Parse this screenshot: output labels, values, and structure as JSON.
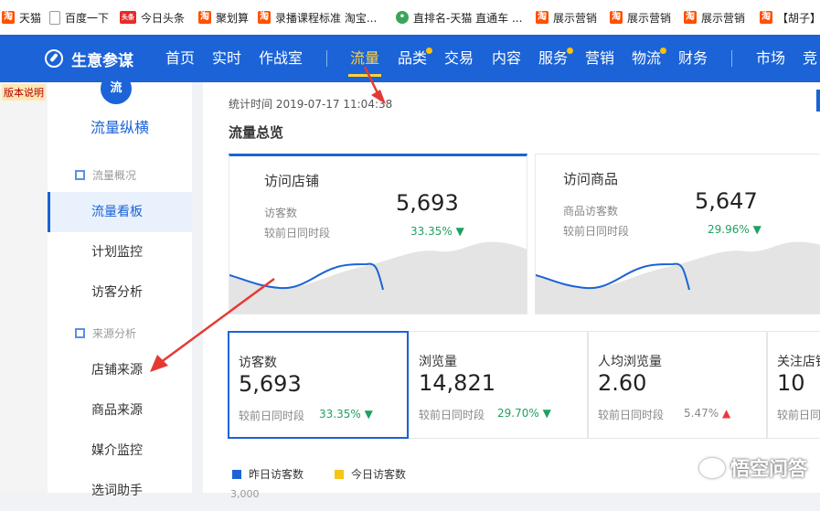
{
  "bookmarks": [
    {
      "icon": "taobao-icon",
      "label": "天猫"
    },
    {
      "icon": "doc-icon",
      "label": "百度一下"
    },
    {
      "icon": "toutiao-icon",
      "label": "今日头条"
    },
    {
      "icon": "taobao-icon",
      "label": "聚划算"
    },
    {
      "icon": "taobao-icon",
      "label": "录播课程标准 淘宝..."
    },
    {
      "icon": "globe-icon",
      "label": "直排名-天猫 直通车 ..."
    },
    {
      "icon": "taobao-icon",
      "label": "展示营销"
    },
    {
      "icon": "taobao-icon",
      "label": "展示营销"
    },
    {
      "icon": "taobao-icon",
      "label": "展示营销"
    },
    {
      "icon": "taobao-icon",
      "label": "【胡子】"
    }
  ],
  "nav": {
    "logo_text": "生意参谋",
    "items": [
      {
        "label": "首页"
      },
      {
        "label": "实时"
      },
      {
        "label": "作战室"
      },
      {
        "label": "流量",
        "active": true
      },
      {
        "label": "品类",
        "dot": true
      },
      {
        "label": "交易"
      },
      {
        "label": "内容"
      },
      {
        "label": "服务",
        "dot": true
      },
      {
        "label": "营销"
      },
      {
        "label": "物流",
        "dot": true
      },
      {
        "label": "财务"
      },
      {
        "label": "市场"
      },
      {
        "label": "竞"
      }
    ]
  },
  "version_note": "版本说明",
  "sidebar": {
    "logo_char": "流",
    "title": "流量纵横",
    "group1": "流量概况",
    "items1": [
      {
        "label": "流量看板",
        "active": true
      },
      {
        "label": "计划监控"
      },
      {
        "label": "访客分析"
      }
    ],
    "group2": "来源分析",
    "items2": [
      {
        "label": "店铺来源"
      },
      {
        "label": "商品来源"
      },
      {
        "label": "媒介监控"
      },
      {
        "label": "选词助手"
      }
    ]
  },
  "main": {
    "stat_time": "统计时间 2019-07-17 11:04:38",
    "header": "流量总览",
    "cards": [
      {
        "title": "访问店铺",
        "label1": "访客数",
        "value": "5,693",
        "label2": "较前日同时段",
        "pct": "33.35%",
        "trend": "down"
      },
      {
        "title": "访问商品",
        "label1": "商品访客数",
        "value": "5,647",
        "label2": "较前日同时段",
        "pct": "29.96%",
        "trend": "down"
      }
    ],
    "metrics": [
      {
        "label": "访客数",
        "value": "5,693",
        "compare": "较前日同时段",
        "pct": "33.35%",
        "trend": "down"
      },
      {
        "label": "浏览量",
        "value": "14,821",
        "compare": "较前日同时段",
        "pct": "29.70%",
        "trend": "down"
      },
      {
        "label": "人均浏览量",
        "value": "2.60",
        "compare": "较前日同时段",
        "pct": "5.47%",
        "trend": "up"
      },
      {
        "label": "关注店铺",
        "value": "10",
        "compare": "较前日同时段",
        "pct": "",
        "trend": "down"
      }
    ],
    "legend": [
      {
        "label": "昨日访客数",
        "color": "#1b63d7"
      },
      {
        "label": "今日访客数",
        "color": "#f5c518"
      }
    ],
    "cut_tick": "3,000"
  },
  "arrows": [
    "▼",
    "▲"
  ],
  "watermark": "悟空问答",
  "colors": {
    "nav_bg": "#1b63d7",
    "active": "#ffd33a",
    "up": "#e8383d",
    "down": "#20a060"
  }
}
